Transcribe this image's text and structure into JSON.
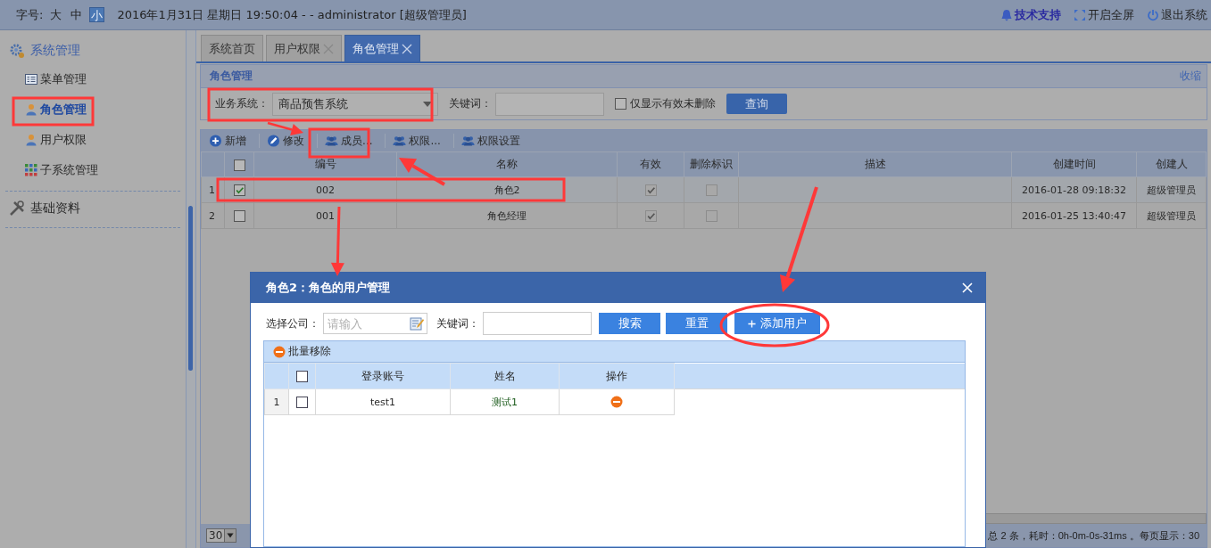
{
  "header": {
    "font_size_label": "字号:",
    "font_sizes": [
      {
        "label": "大",
        "selected": false
      },
      {
        "label": "中",
        "selected": false
      },
      {
        "label": "小",
        "selected": true
      }
    ],
    "info": "2016年1月31日 星期日 19:50:04 - - administrator [超级管理员]",
    "links": [
      {
        "label": "技术支持",
        "kind": "support"
      },
      {
        "label": "开启全屏",
        "kind": "fullscreen"
      },
      {
        "label": "退出系统",
        "kind": "logout"
      }
    ]
  },
  "sidebar": {
    "groups": [
      {
        "title": "系统管理",
        "kind": "gear",
        "children": [
          {
            "label": "菜单管理",
            "kind": "menu",
            "selected": false
          },
          {
            "label": "角色管理",
            "kind": "person",
            "selected": true
          },
          {
            "label": "用户权限",
            "kind": "person",
            "selected": false
          },
          {
            "label": "子系统管理",
            "kind": "grid",
            "selected": false
          }
        ]
      },
      {
        "title": "基础资料",
        "kind": "tools"
      }
    ]
  },
  "tabs": [
    {
      "label": "系统首页",
      "closable": false,
      "selected": false
    },
    {
      "label": "用户权限",
      "closable": true,
      "selected": false
    },
    {
      "label": "角色管理",
      "closable": true,
      "selected": true
    }
  ],
  "panel": {
    "title": "角色管理",
    "collapse_link": "收缩",
    "filters": {
      "system_label": "业务系统：",
      "system_value": "商品预售系统",
      "keyword_label": "关键词：",
      "only_valid_label": "仅显示有效未删除",
      "only_valid_checked": false,
      "query_button": "查询"
    },
    "toolbar": [
      {
        "label": "新增",
        "kind": "add"
      },
      {
        "label": "修改",
        "kind": "edit"
      },
      {
        "label": "成员...",
        "kind": "users"
      },
      {
        "label": "权限...",
        "kind": "users"
      },
      {
        "label": "权限设置",
        "kind": "users"
      }
    ],
    "table": {
      "all_checked": false,
      "columns": [
        "编号",
        "名称",
        "有效",
        "删除标识",
        "描述",
        "创建时间",
        "创建人"
      ],
      "rows": [
        {
          "index": "1",
          "selected": true,
          "code": "002",
          "name": "角色2",
          "valid": true,
          "deleted": false,
          "created": "2016-01-28 09:18:32",
          "creator": "超级管理员"
        },
        {
          "index": "2",
          "selected": false,
          "code": "001",
          "name": "角色经理",
          "valid": true,
          "deleted": false,
          "created": "2016-01-25 13:40:47",
          "creator": "超级管理员"
        }
      ]
    },
    "pager": {
      "page_size": "30",
      "summary": "总 2 条，耗时：0h-0m-0s-31ms 。每页显示：30"
    }
  },
  "dialog": {
    "title": "角色2：角色的用户管理",
    "company_label": "选择公司：",
    "company_placeholder": "请输入",
    "keyword_label": "关键词：",
    "buttons": [
      {
        "label": "搜索",
        "kind": "plain"
      },
      {
        "label": "重置",
        "kind": "plain"
      },
      {
        "label": "添加用户",
        "kind": "add"
      }
    ],
    "grid": {
      "toolbar": "批量移除",
      "all_checked": false,
      "columns": [
        "登录账号",
        "姓名",
        "操作"
      ],
      "rows": [
        {
          "index": "1",
          "checked": false,
          "account": "test1",
          "name": "测试1"
        }
      ]
    }
  }
}
